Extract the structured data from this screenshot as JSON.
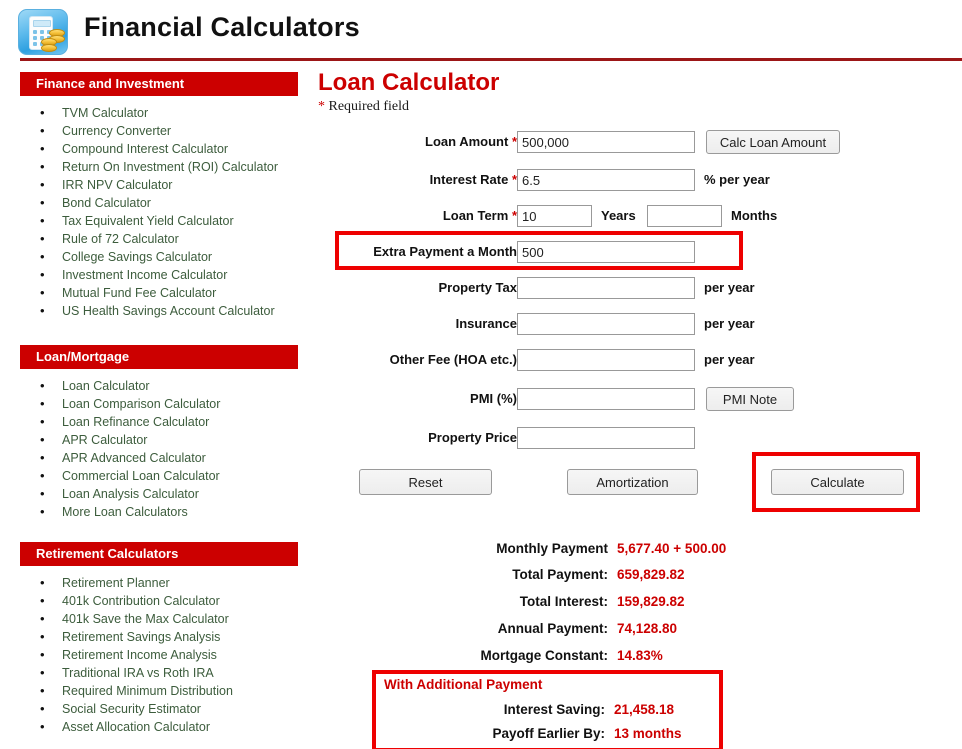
{
  "header": {
    "title": "Financial Calculators",
    "icon": "calculator-coins-icon"
  },
  "sidebar": {
    "sections": [
      {
        "heading": "Finance and Investment",
        "items": [
          "TVM Calculator",
          "Currency Converter",
          "Compound Interest Calculator",
          "Return On Investment (ROI) Calculator",
          "IRR NPV Calculator",
          "Bond Calculator",
          "Tax Equivalent Yield Calculator",
          "Rule of 72 Calculator",
          "College Savings Calculator",
          "Investment Income Calculator",
          "Mutual Fund Fee Calculator",
          "US Health Savings Account Calculator"
        ]
      },
      {
        "heading": "Loan/Mortgage",
        "items": [
          "Loan Calculator",
          "Loan Comparison Calculator",
          "Loan Refinance Calculator",
          "APR Calculator",
          "APR Advanced Calculator",
          "Commercial Loan Calculator",
          "Loan Analysis Calculator",
          "More Loan Calculators"
        ]
      },
      {
        "heading": "Retirement Calculators",
        "items": [
          "Retirement Planner",
          "401k Contribution Calculator",
          "401k Save the Max Calculator",
          "Retirement Savings Analysis",
          "Retirement Income Analysis",
          "Traditional IRA vs Roth IRA",
          "Required Minimum Distribution",
          "Social Security Estimator",
          "Asset Allocation Calculator"
        ]
      }
    ]
  },
  "main": {
    "title": "Loan Calculator",
    "required_note_star": "*",
    "required_note_text": " Required field",
    "fields": {
      "loan_amount": {
        "label": "Loan Amount",
        "required_mark": "*",
        "value": "500,000",
        "button": "Calc Loan Amount"
      },
      "interest_rate": {
        "label": "Interest Rate",
        "required_mark": "*",
        "value": "6.5",
        "unit": "% per year"
      },
      "loan_term": {
        "label": "Loan Term",
        "required_mark": "*",
        "years_value": "10",
        "years_unit": "Years",
        "months_value": "",
        "months_unit": "Months"
      },
      "extra_payment": {
        "label": "Extra Payment a Month",
        "value": "500"
      },
      "property_tax": {
        "label": "Property Tax",
        "value": "",
        "unit": "per year"
      },
      "insurance": {
        "label": "Insurance",
        "value": "",
        "unit": "per year"
      },
      "other_fee": {
        "label": "Other Fee (HOA etc.)",
        "value": "",
        "unit": "per year"
      },
      "pmi": {
        "label": "PMI (%)",
        "value": "",
        "button": "PMI Note"
      },
      "property_price": {
        "label": "Property Price",
        "value": ""
      }
    },
    "actions": {
      "reset": "Reset",
      "amortization": "Amortization",
      "calculate": "Calculate"
    },
    "results": [
      {
        "label": "Monthly Payment",
        "value": "5,677.40 + 500.00"
      },
      {
        "label": "Total Payment:",
        "value": "659,829.82"
      },
      {
        "label": "Total Interest:",
        "value": "159,829.82"
      },
      {
        "label": "Annual Payment:",
        "value": "74,128.80"
      },
      {
        "label": "Mortgage Constant:",
        "value": "14.83%"
      }
    ],
    "additional_payment": {
      "title": "With Additional Payment",
      "rows": [
        {
          "label": "Interest Saving:",
          "value": "21,458.18"
        },
        {
          "label": "Payoff Earlier By:",
          "value": "13 months"
        }
      ]
    }
  },
  "colors": {
    "brand_red": "#cc0000",
    "rule_red": "#9c1617",
    "highlight_red": "#ee0000",
    "link_green": "#3c5c3c"
  }
}
